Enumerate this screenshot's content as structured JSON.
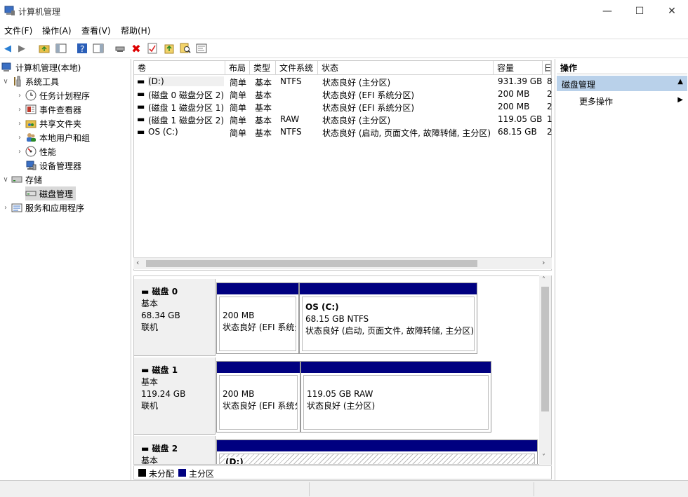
{
  "window": {
    "title": "计算机管理",
    "min": "—",
    "max": "☐",
    "close": "✕"
  },
  "menu": {
    "file": "文件(F)",
    "action": "操作(A)",
    "view": "查看(V)",
    "help": "帮助(H)"
  },
  "tree": {
    "root": "计算机管理(本地)",
    "system_tools": "系统工具",
    "task_scheduler": "任务计划程序",
    "event_viewer": "事件查看器",
    "shared_folders": "共享文件夹",
    "local_users": "本地用户和组",
    "performance": "性能",
    "device_manager": "设备管理器",
    "storage": "存储",
    "disk_management": "磁盘管理",
    "services_apps": "服务和应用程序"
  },
  "volumes": {
    "headers": {
      "vol": "卷",
      "layout": "布局",
      "type": "类型",
      "fs": "文件系统",
      "status": "状态",
      "capacity": "容量",
      "extra": "日"
    },
    "rows": [
      {
        "vol": "(D:)",
        "layout": "简单",
        "type": "基本",
        "fs": "NTFS",
        "status": "状态良好 (主分区)",
        "capacity": "931.39 GB",
        "extra": "8"
      },
      {
        "vol": "(磁盘 0 磁盘分区 2)",
        "layout": "简单",
        "type": "基本",
        "fs": "",
        "status": "状态良好 (EFI 系统分区)",
        "capacity": "200 MB",
        "extra": "2"
      },
      {
        "vol": "(磁盘 1 磁盘分区 1)",
        "layout": "简单",
        "type": "基本",
        "fs": "",
        "status": "状态良好 (EFI 系统分区)",
        "capacity": "200 MB",
        "extra": "2"
      },
      {
        "vol": "(磁盘 1 磁盘分区 2)",
        "layout": "简单",
        "type": "基本",
        "fs": "RAW",
        "status": "状态良好 (主分区)",
        "capacity": "119.05 GB",
        "extra": "1"
      },
      {
        "vol": "OS (C:)",
        "layout": "简单",
        "type": "基本",
        "fs": "NTFS",
        "status": "状态良好 (启动, 页面文件, 故障转储, 主分区)",
        "capacity": "68.15 GB",
        "extra": "2"
      }
    ]
  },
  "disks": {
    "d0": {
      "name": "磁盘 0",
      "type": "基本",
      "size": "68.34 GB",
      "state": "联机",
      "p1": {
        "size": "200 MB",
        "status": "状态良好 (EFI 系统分"
      },
      "p2": {
        "name": "OS  (C:)",
        "size": "68.15 GB NTFS",
        "status": "状态良好 (启动, 页面文件, 故障转储, 主分区)"
      }
    },
    "d1": {
      "name": "磁盘 1",
      "type": "基本",
      "size": "119.24 GB",
      "state": "联机",
      "p1": {
        "size": "200 MB",
        "status": "状态良好 (EFI 系统分"
      },
      "p2": {
        "size": "119.05 GB RAW",
        "status": "状态良好 (主分区)"
      }
    },
    "d2": {
      "name": "磁盘 2",
      "type": "基本",
      "p1": {
        "name": "(D:)"
      }
    }
  },
  "legend": {
    "unallocated": "未分配",
    "primary": "主分区",
    "unallocated_color": "#000000",
    "primary_color": "#000080"
  },
  "actions": {
    "header": "操作",
    "section": "磁盘管理",
    "more": "更多操作"
  }
}
